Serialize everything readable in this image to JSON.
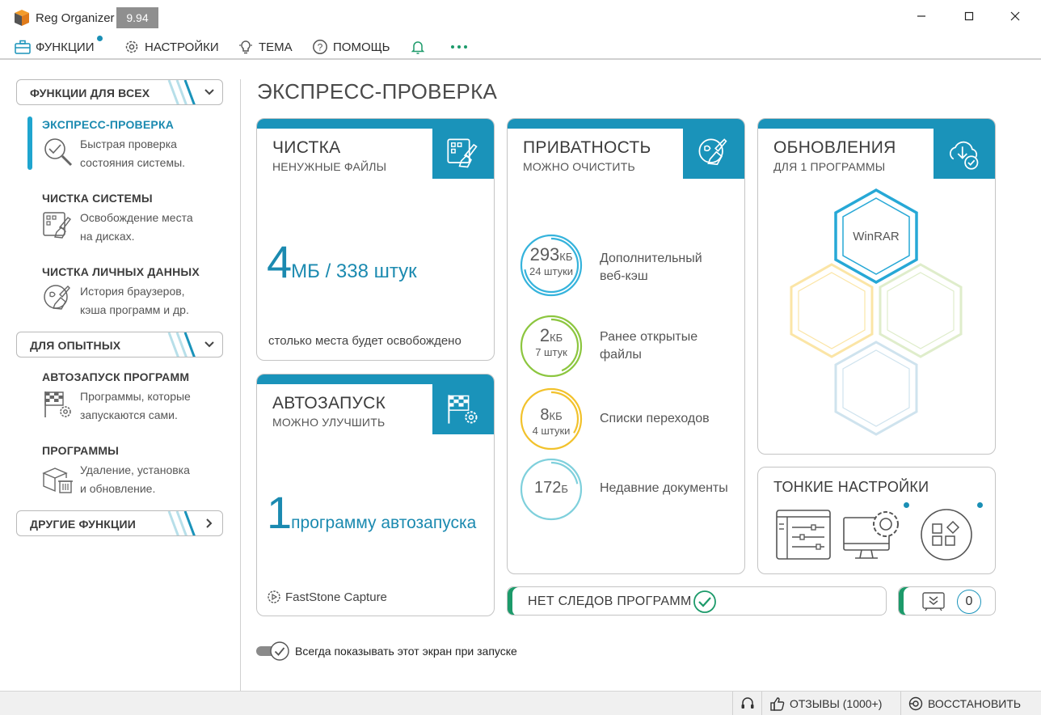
{
  "window": {
    "title": "Reg Organizer",
    "version": "9.94"
  },
  "menu": {
    "functions": "ФУНКЦИИ",
    "settings": "НАСТРОЙКИ",
    "theme": "ТЕМА",
    "help": "ПОМОЩЬ"
  },
  "sidebar": {
    "group_all": "ФУНКЦИИ ДЛЯ ВСЕХ",
    "group_advanced": "ДЛЯ ОПЫТНЫХ",
    "group_other": "ДРУГИЕ ФУНКЦИИ",
    "items": [
      {
        "title": "ЭКСПРЕСС-ПРОВЕРКА",
        "desc1": "Быстрая проверка",
        "desc2": "состояния системы."
      },
      {
        "title": "ЧИСТКА СИСТЕМЫ",
        "desc1": "Освобождение места",
        "desc2": "на дисках."
      },
      {
        "title": "ЧИСТКА ЛИЧНЫХ ДАННЫХ",
        "desc1": "История браузеров,",
        "desc2": "кэша программ и др."
      },
      {
        "title": "АВТОЗАПУСК ПРОГРАММ",
        "desc1": "Программы, которые",
        "desc2": "запускаются сами."
      },
      {
        "title": "ПРОГРАММЫ",
        "desc1": "Удаление, установка",
        "desc2": "и обновление."
      }
    ]
  },
  "main": {
    "title": "ЭКСПРЕСС-ПРОВЕРКА",
    "cleanup": {
      "title": "ЧИСТКА",
      "subtitle": "НЕНУЖНЫЕ ФАЙЛЫ",
      "big_num": "4",
      "big_rest": "МБ / 338 штук",
      "footer": "столько места будет освобождено"
    },
    "autorun": {
      "title": "АВТОЗАПУСК",
      "subtitle": "МОЖНО УЛУЧШИТЬ",
      "big_num": "1",
      "big_rest": "программу автозапуска",
      "footer": "FastStone Capture"
    },
    "privacy": {
      "title": "ПРИВАТНОСТЬ",
      "subtitle": "МОЖНО ОЧИСТИТЬ",
      "items": [
        {
          "num": "293",
          "unit": "КБ",
          "count": "24 штуки",
          "label1": "Дополнительный",
          "label2": "веб-кэш",
          "color": "#35b3dc"
        },
        {
          "num": "2",
          "unit": "КБ",
          "count": "7 штук",
          "label1": "Ранее открытые",
          "label2": "файлы",
          "color": "#8cc63f"
        },
        {
          "num": "8",
          "unit": "КБ",
          "count": "4 штуки",
          "label1": "Списки переходов",
          "label2": "",
          "color": "#f2c22c"
        },
        {
          "num": "172",
          "unit": "Б",
          "count": "",
          "label1": "Недавние документы",
          "label2": "",
          "color": "#7fd0dc"
        }
      ]
    },
    "updates": {
      "title": "ОБНОВЛЕНИЯ",
      "subtitle": "ДЛЯ 1 ПРОГРАММЫ",
      "program": "WinRAR"
    },
    "tweaks": {
      "title": "ТОНКИЕ НАСТРОЙКИ"
    },
    "no_traces": "НЕТ СЛЕДОВ ПРОГРАММ",
    "counter": "0",
    "show_on_start": "Всегда показывать этот экран при запуске"
  },
  "statusbar": {
    "reviews": "ОТЗЫВЫ (1000+)",
    "restore": "ВОССТАНОВИТЬ"
  },
  "colors": {
    "accent": "#1a93ba",
    "accent_text": "#1b8ab0",
    "green": "#1c9a6a"
  }
}
